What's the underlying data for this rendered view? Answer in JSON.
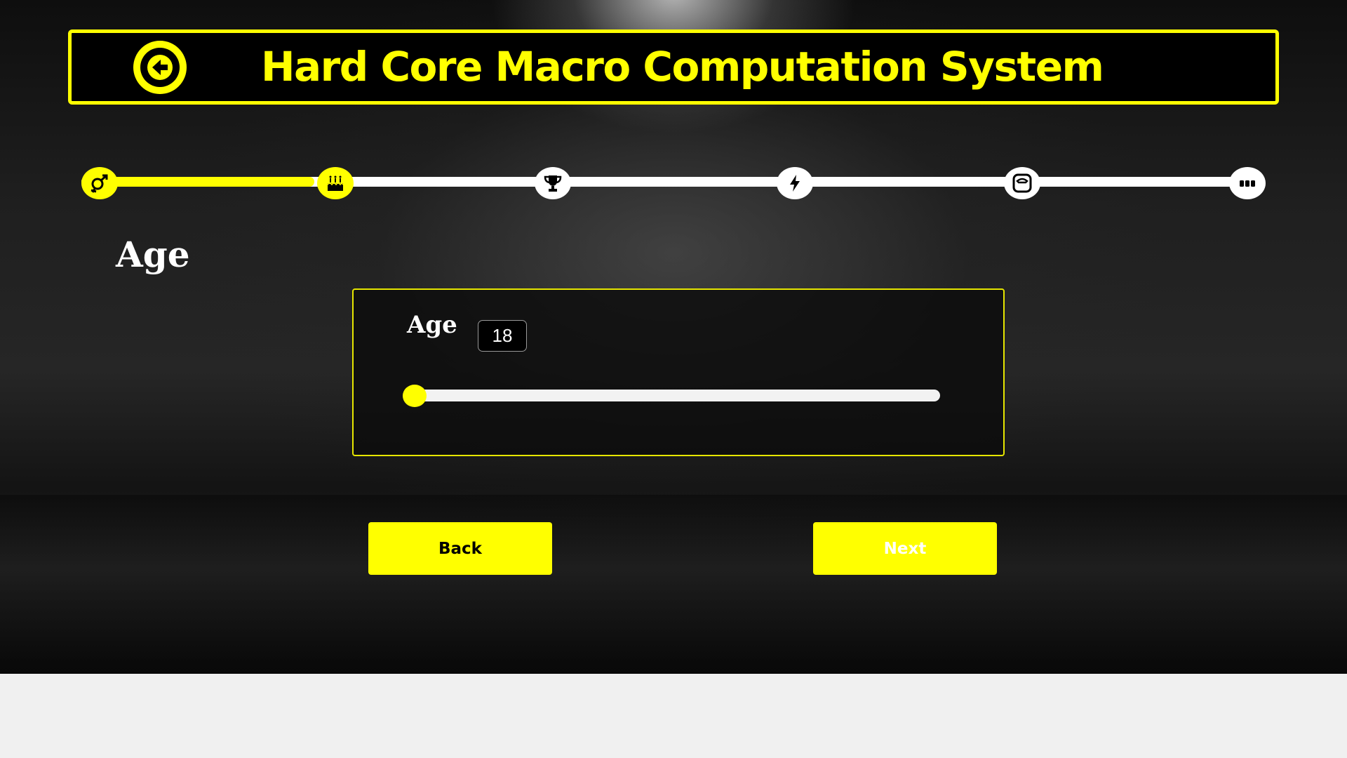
{
  "header": {
    "title": "Hard Core Macro Computation System",
    "back_icon": "arrow-left-circle-icon"
  },
  "progress": {
    "completed_fraction": 0.2,
    "steps": [
      {
        "icon": "gender-icon",
        "state": "done"
      },
      {
        "icon": "birthday-cake-icon",
        "state": "current"
      },
      {
        "icon": "trophy-icon",
        "state": "todo"
      },
      {
        "icon": "lightning-icon",
        "state": "todo"
      },
      {
        "icon": "scale-icon",
        "state": "todo"
      },
      {
        "icon": "more-icon",
        "state": "todo"
      }
    ]
  },
  "section": {
    "title": "Age"
  },
  "age_field": {
    "label": "Age",
    "value": "18",
    "slider_fraction": 0.0
  },
  "buttons": {
    "back_label": "Back",
    "next_label": "Next"
  },
  "colors": {
    "accent": "#ffff00",
    "background": "#1a1a1a",
    "page_bottom": "#f0f0f0",
    "text": "#ffffff"
  }
}
